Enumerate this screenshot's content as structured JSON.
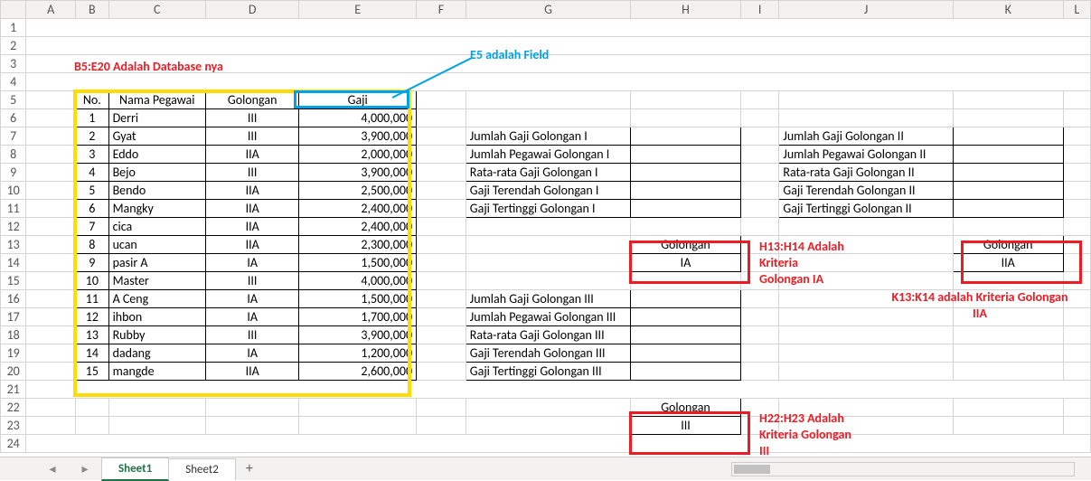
{
  "columns": [
    "A",
    "B",
    "C",
    "D",
    "E",
    "F",
    "G",
    "H",
    "I",
    "J",
    "K",
    "L"
  ],
  "rowcount": 24,
  "headers": {
    "no": "No.",
    "nama": "Nama Pegawai",
    "gol": "Golongan",
    "gaji": "Gaji"
  },
  "employees": [
    {
      "no": "1",
      "nama": "Derri",
      "gol": "III",
      "gaji": "4,000,000"
    },
    {
      "no": "2",
      "nama": "Gyat",
      "gol": "III",
      "gaji": "3,900,000"
    },
    {
      "no": "3",
      "nama": "Eddo",
      "gol": "IIA",
      "gaji": "2,000,000"
    },
    {
      "no": "4",
      "nama": "Bejo",
      "gol": "III",
      "gaji": "3,900,000"
    },
    {
      "no": "5",
      "nama": "Bendo",
      "gol": "IIA",
      "gaji": "2,500,000"
    },
    {
      "no": "6",
      "nama": "Mangky",
      "gol": "IIA",
      "gaji": "2,400,000"
    },
    {
      "no": "7",
      "nama": "cica",
      "gol": "IIA",
      "gaji": "2,400,000"
    },
    {
      "no": "8",
      "nama": "ucan",
      "gol": "IIA",
      "gaji": "2,300,000"
    },
    {
      "no": "9",
      "nama": "pasir A",
      "gol": "IA",
      "gaji": "1,500,000"
    },
    {
      "no": "10",
      "nama": "Master",
      "gol": "III",
      "gaji": "4,000,000"
    },
    {
      "no": "11",
      "nama": "A Ceng",
      "gol": "IA",
      "gaji": "1,500,000"
    },
    {
      "no": "12",
      "nama": "ihbon",
      "gol": "IA",
      "gaji": "1,700,000"
    },
    {
      "no": "13",
      "nama": "Rubby",
      "gol": "III",
      "gaji": "3,900,000"
    },
    {
      "no": "14",
      "nama": "dadang",
      "gol": "IA",
      "gaji": "1,200,000"
    },
    {
      "no": "15",
      "nama": "mangde",
      "gol": "IIA",
      "gaji": "2,600,000"
    }
  ],
  "stats1": [
    "Jumlah Gaji Golongan I",
    "Jumlah Pegawai Golongan I",
    "Rata-rata Gaji Golongan I",
    "Gaji Terendah Golongan I",
    "Gaji Tertinggi Golongan I"
  ],
  "stats2": [
    "Jumlah Gaji Golongan II",
    "Jumlah Pegawai Golongan II",
    "Rata-rata Gaji Golongan II",
    "Gaji Terendah Golongan II",
    "Gaji Tertinggi Golongan II"
  ],
  "stats3": [
    "Jumlah Gaji Golongan III",
    "Jumlah Pegawai Golongan III",
    "Rata-rata Gaji Golongan III",
    "Gaji Terendah Golongan III",
    "Gaji Tertinggi Golongan III"
  ],
  "crit": {
    "label": "Golongan",
    "ia": "IA",
    "iia": "IIA",
    "iii": "III"
  },
  "annot": {
    "dbnote": "B5:E20 Adalah Database nya",
    "fieldnote": "E5 adalah Field",
    "h13": "H13:H14 Adalah",
    "h13b": "Kriteria",
    "h13c": "Golongan IA",
    "k13": "K13:K14 adalah Kriteria Golongan",
    "k13b": "IIA",
    "h22": "H22:H23 Adalah",
    "h22b": "Kriteria Golongan",
    "h22c": "III"
  },
  "tabs": {
    "s1": "Sheet1",
    "s2": "Sheet2",
    "add": "+"
  },
  "nav": {
    "left": "◂",
    "right": "▸"
  }
}
